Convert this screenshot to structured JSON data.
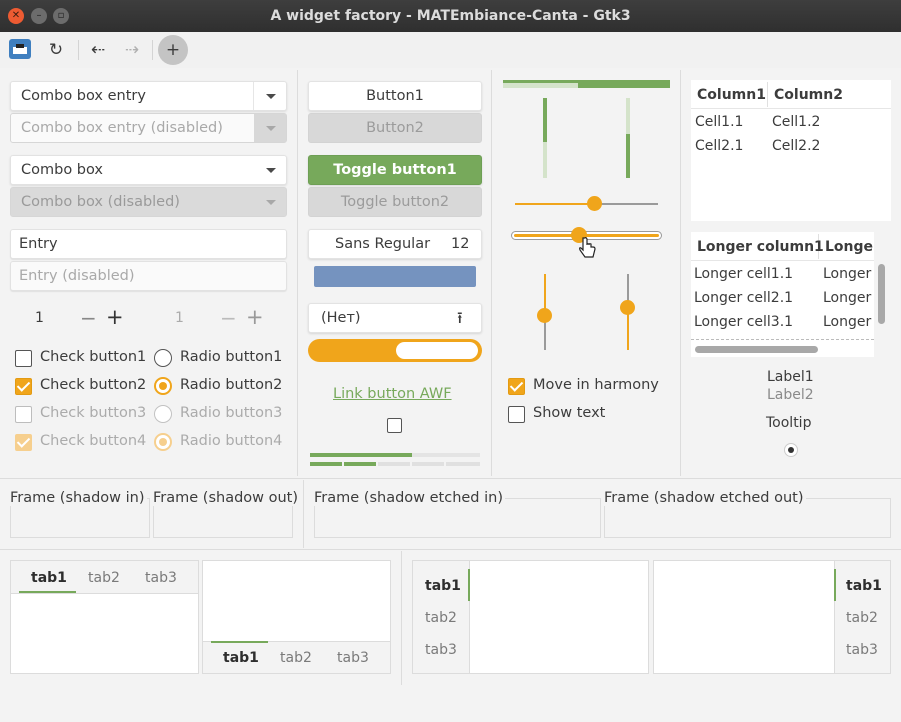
{
  "window": {
    "title": "A widget factory - MATEmbiance-Canta - Gtk3"
  },
  "toolbar": {
    "items": [
      "app-icon",
      "refresh-icon",
      "back-icon",
      "forward-icon",
      "add-icon"
    ]
  },
  "col1": {
    "combo_entry": "Combo box entry",
    "combo_entry_disabled": "Combo box entry (disabled)",
    "combo_box": "Combo box",
    "combo_box_disabled": "Combo box (disabled)",
    "entry": "Entry",
    "entry_disabled_placeholder": "Entry (disabled)",
    "spin1_value": "1",
    "spin2_value": "1",
    "check1": "Check button1",
    "check2": "Check button2",
    "check3": "Check button3",
    "check4": "Check button4",
    "radio1": "Radio button1",
    "radio2": "Radio button2",
    "radio3": "Radio button3",
    "radio4": "Radio button4"
  },
  "col2": {
    "button1": "Button1",
    "button2": "Button2",
    "toggle1": "Toggle button1",
    "toggle2": "Toggle button2",
    "font_name": "Sans Regular",
    "font_size": "12",
    "file_chooser": "(Нет)",
    "link_button": "Link button AWF",
    "progress_fraction": 0.6
  },
  "col3": {
    "move_in_harmony": "Move in harmony",
    "show_text": "Show text"
  },
  "col4": {
    "tree1": {
      "headers": [
        "Column1",
        "Column2"
      ],
      "rows": [
        [
          "Cell1.1",
          "Cell1.2"
        ],
        [
          "Cell2.1",
          "Cell2.2"
        ]
      ]
    },
    "tree2": {
      "headers": [
        "Longer column1",
        "Longer"
      ],
      "rows": [
        [
          "Longer cell1.1",
          "Longer"
        ],
        [
          "Longer cell2.1",
          "Longer"
        ],
        [
          "Longer cell3.1",
          "Longer"
        ]
      ]
    },
    "label1": "Label1",
    "label2": "Label2",
    "tooltip": "Tooltip"
  },
  "frames": {
    "shadow_in": "Frame (shadow in)",
    "shadow_out": "Frame (shadow out)",
    "etched_in": "Frame (shadow etched in)",
    "etched_out": "Frame (shadow etched out)"
  },
  "notebooks": {
    "tabs": [
      "tab1",
      "tab2",
      "tab3"
    ]
  },
  "colors": {
    "accent_green": "#77a95b",
    "accent_orange": "#f0a51b",
    "titlebar": "#333333"
  }
}
